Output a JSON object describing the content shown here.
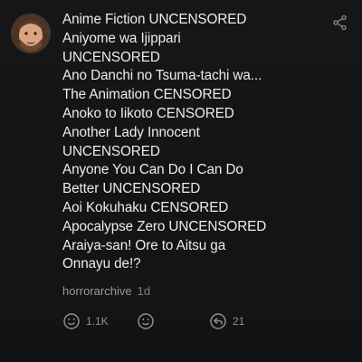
{
  "post": {
    "lines": [
      "Anime Fiction UNCENSORED",
      "Aniyome wa Ijippari",
      "UNCENSORED",
      "Ano Danchi no Tsuma-tachi wa...",
      "The Animation CENSORED",
      "Anoko to Iikoto CENSORED",
      "Another Lady Innocent",
      "UNCENSORED",
      "Anyone You Can Do I Can Do",
      "Better UNCENSORED",
      "Aoi Kokuhaku CENSORED",
      "Apocalypse Zero UNCENSORED",
      "Araiya-san! Ore to Aitsu ga",
      "Onnayu de!?"
    ],
    "author": "horrorarchive",
    "time": "1d"
  },
  "actions": {
    "reactions_count": "1.1K",
    "replies_count": "21"
  },
  "icons": {
    "avatar": "user-avatar",
    "share": "share-icon",
    "reaction": "smiley-reaction-icon",
    "add_reaction": "add-reaction-icon",
    "reply": "reply-icon"
  },
  "colors": {
    "background": "#141416",
    "text": "#ececec",
    "muted": "#9a9a9f"
  }
}
